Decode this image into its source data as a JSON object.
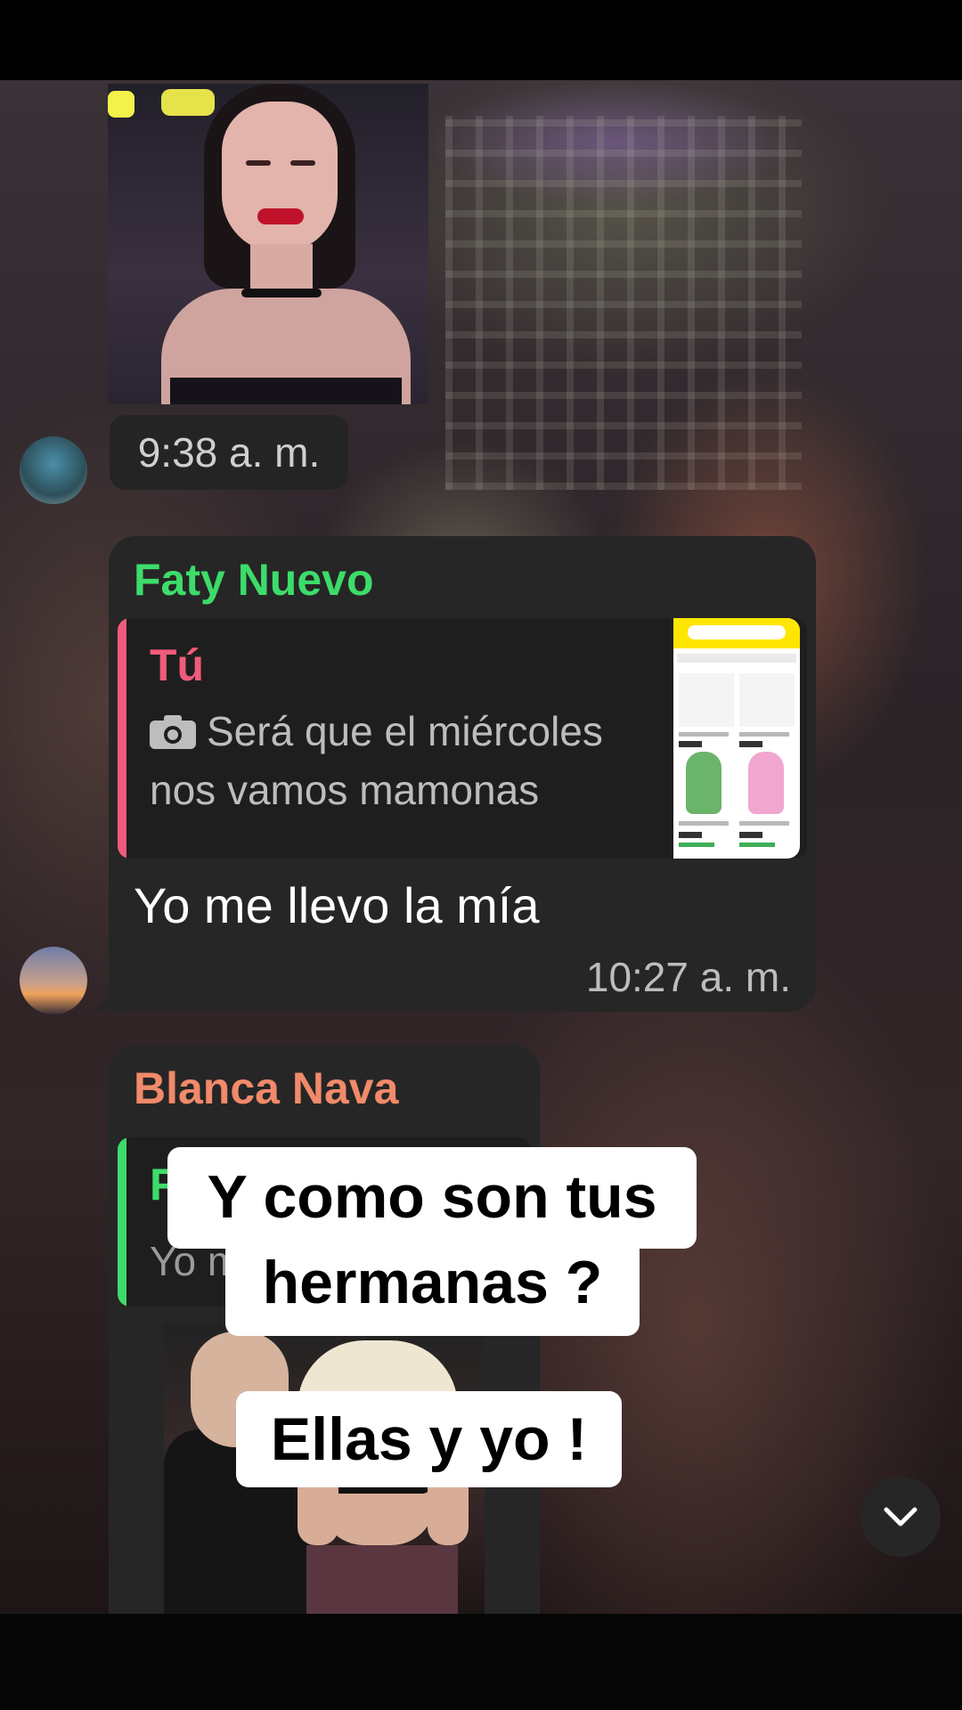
{
  "messages": [
    {
      "type": "sticker",
      "time": "9:38 a. m."
    },
    {
      "type": "reply",
      "sender": "Faty Nuevo",
      "quoted_author": "Tú",
      "quoted_text_line1": "Será que el miércoles",
      "quoted_text_line2": "nos vamos mamonas",
      "quoted_icon": "camera-icon",
      "text": "Yo me llevo la mía",
      "time": "10:27 a. m."
    },
    {
      "type": "reply-gif",
      "sender": "Blanca Nava",
      "quoted_author": "F",
      "quoted_text": "Yo m"
    }
  ],
  "overlay": {
    "caption_1": "Y como son tus",
    "caption_2": "hermanas ?",
    "caption_3": "Ellas y yo !"
  },
  "controls": {
    "scroll_down_icon": "chevron-down-icon"
  },
  "colors": {
    "bubble": "#262626",
    "sender_faty": "#3ddc6a",
    "sender_blanca": "#f08a6a",
    "quote_you": "#ef5b7b"
  }
}
